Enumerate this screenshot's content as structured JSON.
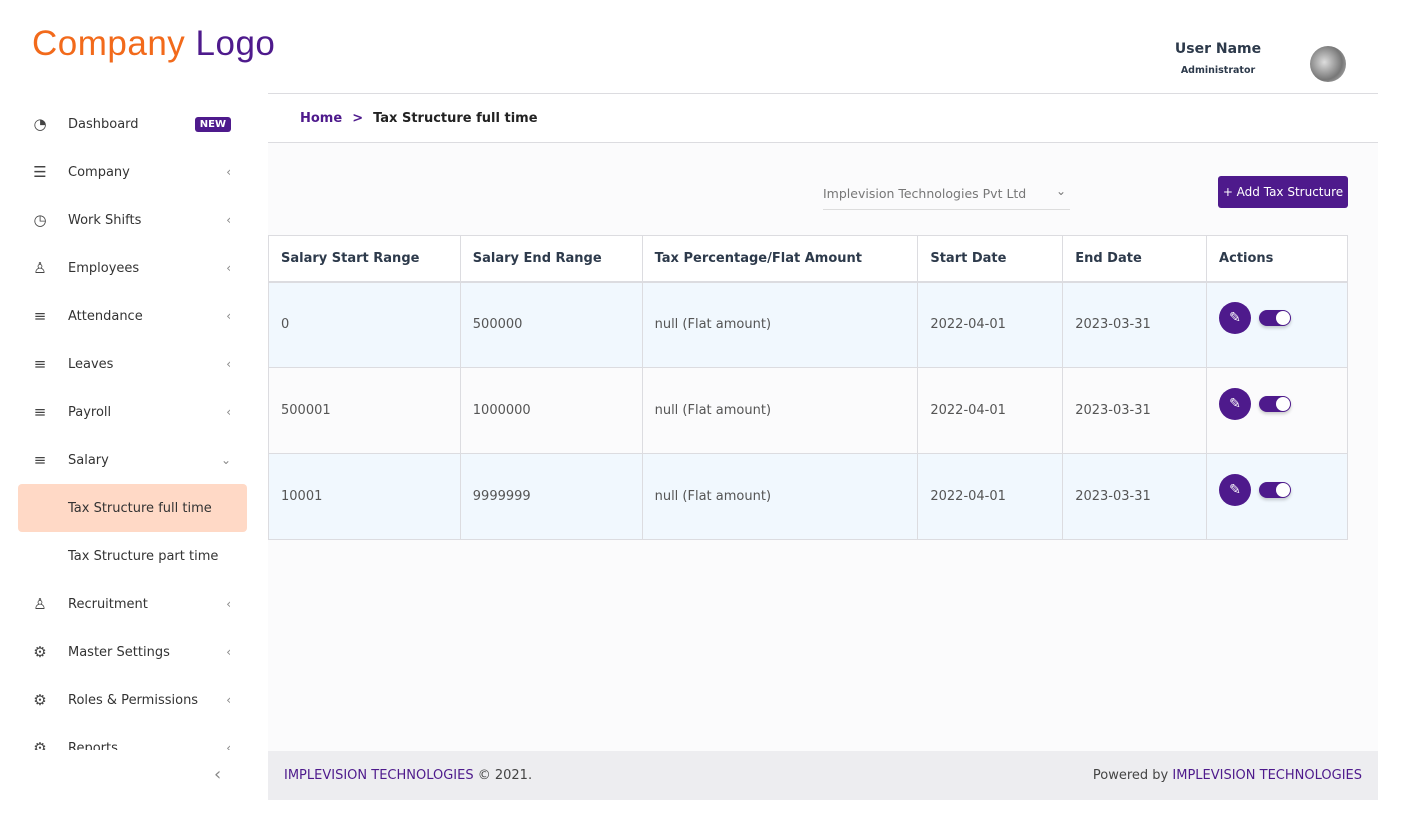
{
  "logo": {
    "part1": "Company",
    "part2": "Logo"
  },
  "user": {
    "name": "User Name",
    "role": "Administrator"
  },
  "sidebar": {
    "items": [
      {
        "label": "Dashboard",
        "icon": "gauge-icon",
        "glyph": "◔",
        "badge": "NEW"
      },
      {
        "label": "Company",
        "icon": "list-icon",
        "glyph": "☰",
        "chevron": "‹"
      },
      {
        "label": "Work Shifts",
        "icon": "clock-icon",
        "glyph": "◷",
        "chevron": "‹"
      },
      {
        "label": "Employees",
        "icon": "user-icon",
        "glyph": "♙",
        "chevron": "‹"
      },
      {
        "label": "Attendance",
        "icon": "lines-icon",
        "glyph": "≡",
        "chevron": "‹"
      },
      {
        "label": "Leaves",
        "icon": "lines-icon",
        "glyph": "≡",
        "chevron": "‹"
      },
      {
        "label": "Payroll",
        "icon": "lines-icon",
        "glyph": "≡",
        "chevron": "‹"
      },
      {
        "label": "Salary",
        "icon": "lines-icon",
        "glyph": "≡",
        "chevron": "⌄"
      },
      {
        "label": "Tax Structure full time",
        "active": true
      },
      {
        "label": "Tax Structure part time"
      },
      {
        "label": "Recruitment",
        "icon": "user-plus-icon",
        "glyph": "♙",
        "chevron": "‹"
      },
      {
        "label": "Master Settings",
        "icon": "gear-icon",
        "glyph": "⚙",
        "chevron": "‹"
      },
      {
        "label": "Roles & Permissions",
        "icon": "gear-icon",
        "glyph": "⚙",
        "chevron": "‹"
      },
      {
        "label": "Reports",
        "icon": "gear-icon",
        "glyph": "⚙",
        "chevron": "‹"
      }
    ],
    "collapse": "‹"
  },
  "breadcrumb": {
    "home": "Home",
    "sep": ">",
    "current": "Tax Structure full time"
  },
  "filter": {
    "company": "Implevision Technologies Pvt Ltd",
    "arrow": "⌄"
  },
  "add_button": "+ Add Tax Structure",
  "table": {
    "headers": [
      "Salary Start Range",
      "Salary End Range",
      "Tax Percentage/Flat Amount",
      "Start Date",
      "End Date",
      "Actions"
    ],
    "rows": [
      [
        "0",
        "500000",
        "null (Flat amount)",
        "2022-04-01",
        "2023-03-31"
      ],
      [
        "500001",
        "1000000",
        "null (Flat amount)",
        "2022-04-01",
        "2023-03-31"
      ],
      [
        "10001",
        "9999999",
        "null (Flat amount)",
        "2022-04-01",
        "2023-03-31"
      ]
    ],
    "toggle_states": [
      true,
      true,
      true
    ]
  },
  "footer": {
    "left_brand": "IMPLEVISION TECHNOLOGIES",
    "left_rest": " © 2021.",
    "right_prefix": "Powered by ",
    "right_brand": "IMPLEVISION TECHNOLOGIES"
  },
  "colors": {
    "primary": "#4e1a8c",
    "accent": "#f26a1b",
    "active_bg": "#ffd9c6"
  }
}
